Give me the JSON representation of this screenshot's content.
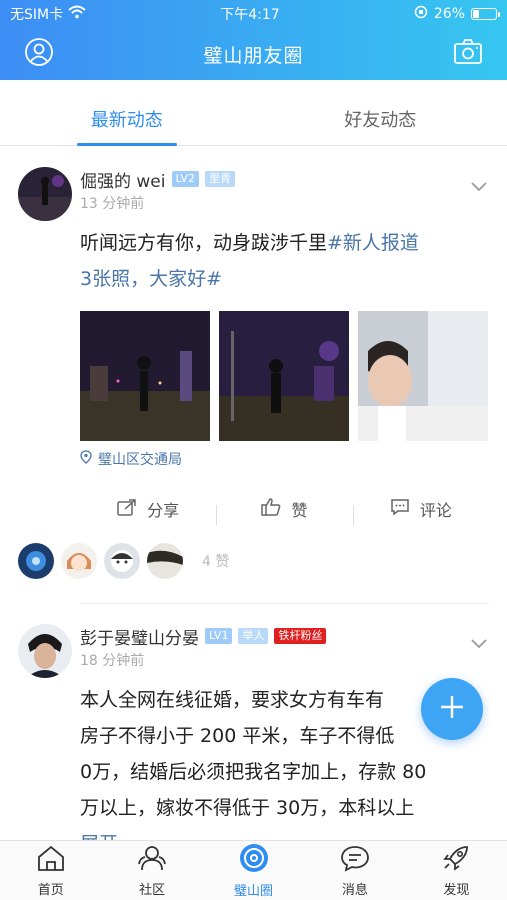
{
  "status_bar": {
    "carrier": "无SIM卡",
    "time": "下午4:17",
    "battery": "26%",
    "battery_level": 0.26
  },
  "header": {
    "title": "璧山朋友圈"
  },
  "tabs": [
    {
      "label": "最新动态",
      "active": true
    },
    {
      "label": "好友动态",
      "active": false
    }
  ],
  "posts": [
    {
      "name": "倔强的 wei",
      "level": "LV2",
      "tag": "里青",
      "time": "13 分钟前",
      "text": "听闻远方有你，动身跋涉千里",
      "hashtag_line1": "#新人报道",
      "hashtag_line2": "3张照，大家好#",
      "location": "璧山区交通局",
      "actions": {
        "share": "分享",
        "like": "赞",
        "comment": "评论"
      },
      "like_count": "4 赞"
    },
    {
      "name": "彭于晏璧山分晏",
      "level": "LV1",
      "tag": "举人",
      "fan_badge": "铁杆粉丝",
      "time": "18 分钟前",
      "text_lines": [
        "本人全网在线征婚，要求女方有车有",
        "房子不得小于 200 平米，车子不得低",
        "0万，结婚后必须把我名字加上，存款 80",
        "万以上，嫁妆不得低于 30万，本科以上"
      ],
      "expand": "展开"
    }
  ],
  "bottom_nav": [
    {
      "label": "首页",
      "icon": "home-icon"
    },
    {
      "label": "社区",
      "icon": "community-icon"
    },
    {
      "label": "璧山圈",
      "icon": "circle-icon",
      "active": true
    },
    {
      "label": "消息",
      "icon": "message-icon"
    },
    {
      "label": "发现",
      "icon": "discover-icon"
    }
  ],
  "colors": {
    "accent": "#2f8cf0",
    "header_start": "#3d8df4",
    "header_end": "#36c6f0",
    "link": "#4a76a8"
  }
}
